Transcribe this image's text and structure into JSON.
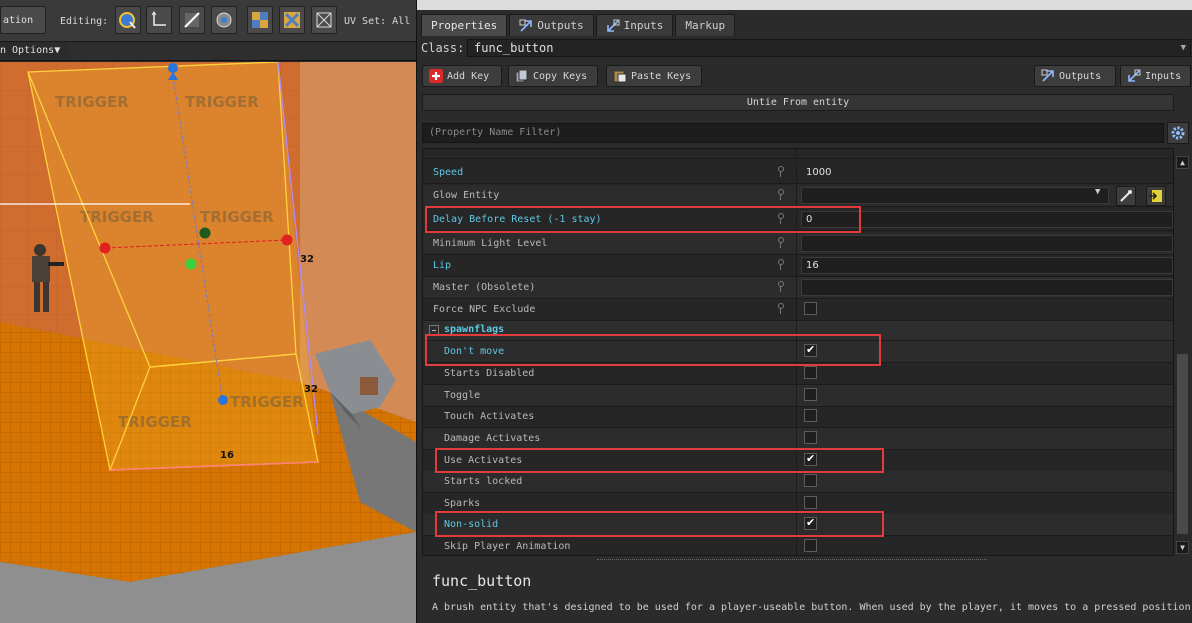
{
  "viewport": {
    "toolbar": {
      "left_partial_label": "ation",
      "editing_label": "Editing:",
      "uv_set_label": "UV Set: All",
      "options_label": "n Options"
    },
    "scene": {
      "trigger_text": "TRIGGER",
      "dim_height": "32",
      "dim_depth": "32",
      "dim_width": "16",
      "colors": {
        "ground": "#d37400",
        "wall": "#c9672c",
        "bbox": "#ffd23c",
        "handle_red": "#e12020",
        "handle_blue": "#2a74e0",
        "handle_green": "#2ab040"
      }
    }
  },
  "panel": {
    "tabs": [
      {
        "label": "Properties",
        "icon": "none"
      },
      {
        "label": "Outputs",
        "icon": "outputs-icon"
      },
      {
        "label": "Inputs",
        "icon": "inputs-icon"
      },
      {
        "label": "Markup",
        "icon": "none"
      }
    ],
    "class_label": "Class:",
    "class_value": "func_button",
    "buttons": {
      "add_key": "Add Key",
      "copy_keys": "Copy Keys",
      "paste_keys": "Paste Keys",
      "outputs": "Outputs",
      "inputs": "Inputs",
      "untie": "Untie From entity"
    },
    "filter_placeholder": "(Property Name Filter)",
    "properties": [
      {
        "name": "Speed",
        "value": "1000",
        "highlight": true
      },
      {
        "name": "Glow Entity",
        "value": "",
        "highlight": false
      },
      {
        "name": "Delay Before Reset (-1 stay)",
        "value": "0",
        "highlight": true
      },
      {
        "name": "Minimum Light Level",
        "value": "",
        "highlight": false
      },
      {
        "name": "Lip",
        "value": "16",
        "highlight": true
      },
      {
        "name": "Master (Obsolete)",
        "value": "",
        "highlight": false
      },
      {
        "name": "Force NPC Exclude",
        "value": "",
        "highlight": false
      }
    ],
    "group_label": "spawnflags",
    "flags": [
      {
        "name": "Don't move",
        "checked": true,
        "highlight": true
      },
      {
        "name": "Starts Disabled",
        "checked": false,
        "highlight": false
      },
      {
        "name": "Toggle",
        "checked": false,
        "highlight": false
      },
      {
        "name": "Touch Activates",
        "checked": false,
        "highlight": false
      },
      {
        "name": "Damage Activates",
        "checked": false,
        "highlight": false
      },
      {
        "name": "Use Activates",
        "checked": true,
        "highlight": false
      },
      {
        "name": "Starts locked",
        "checked": false,
        "highlight": false
      },
      {
        "name": "Sparks",
        "checked": false,
        "highlight": false
      },
      {
        "name": "Non-solid",
        "checked": true,
        "highlight": true
      },
      {
        "name": "Skip Player Animation",
        "checked": false,
        "highlight": false
      }
    ],
    "help": {
      "title": "func_button",
      "description": "A brush entity that's designed to be used for a player-useable button. When used by the player, it moves to a pressed position."
    }
  }
}
